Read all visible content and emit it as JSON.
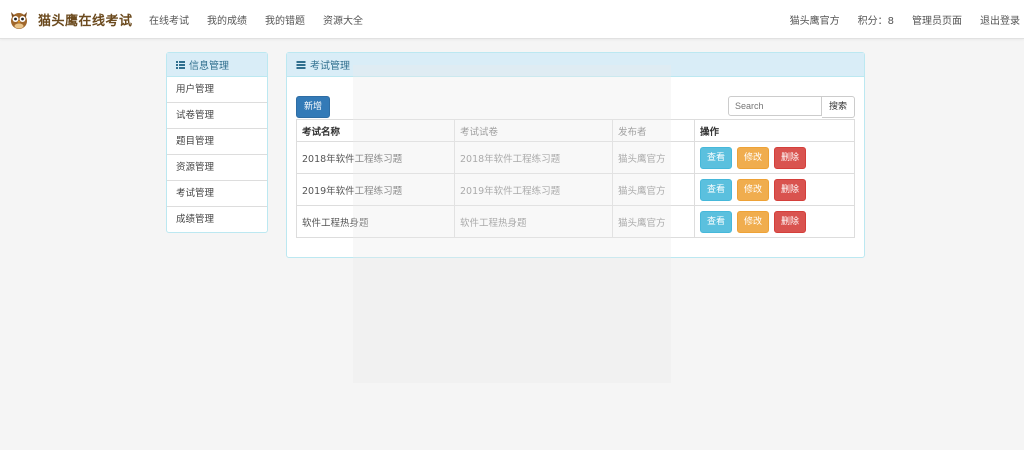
{
  "brand": {
    "name": "猫头鹰在线考试",
    "logo_icon": "owl-logo-icon"
  },
  "nav": {
    "left": [
      "在线考试",
      "我的成绩",
      "我的错题",
      "资源大全"
    ],
    "user": "猫头鹰官方",
    "points": "积分：8",
    "admin": "管理员页面",
    "logout": "退出登录"
  },
  "sidebar": {
    "title": "信息管理",
    "items": [
      "用户管理",
      "试卷管理",
      "题目管理",
      "资源管理",
      "考试管理",
      "成绩管理"
    ]
  },
  "main": {
    "title": "考试管理",
    "add_label": "新增",
    "search_placeholder": "Search",
    "search_label": "搜索",
    "columns": [
      "考试名称",
      "考试试卷",
      "发布者",
      "操作"
    ],
    "rows": [
      {
        "name": "2018年软件工程练习题",
        "paper": "2018年软件工程练习题",
        "publisher": "猫头鹰官方"
      },
      {
        "name": "2019年软件工程练习题",
        "paper": "2019年软件工程练习题",
        "publisher": "猫头鹰官方"
      },
      {
        "name": "软件工程热身题",
        "paper": "软件工程热身题",
        "publisher": "猫头鹰官方"
      }
    ],
    "actions": {
      "view": "查看",
      "edit": "修改",
      "delete": "删除"
    }
  },
  "colors": {
    "primary": "#337ab7",
    "info": "#5bc0de",
    "warning": "#f0ad4e",
    "danger": "#d9534f",
    "panel_head": "#d9edf7"
  }
}
